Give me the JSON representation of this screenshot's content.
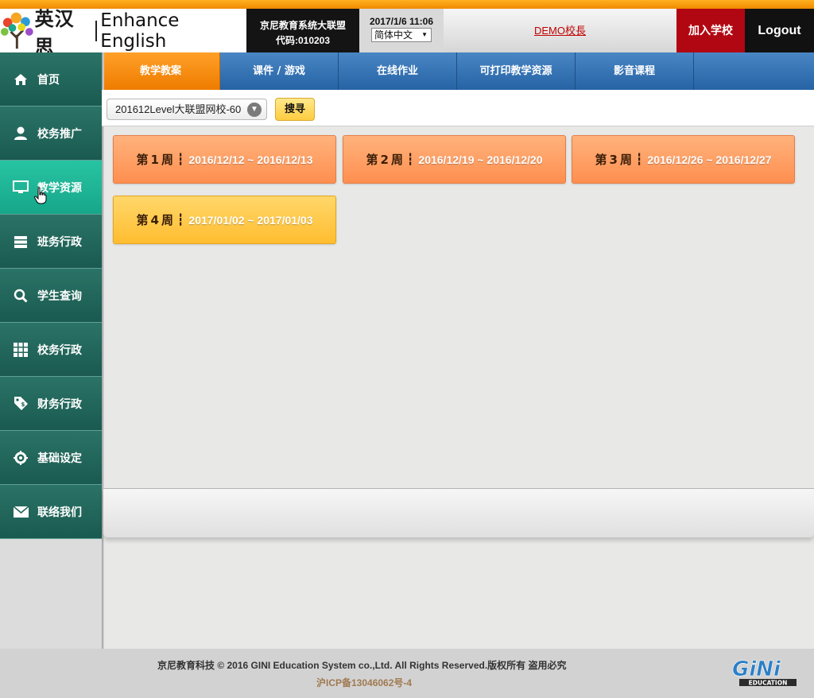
{
  "header": {
    "logo_cn": "英汉思",
    "logo_en": "Enhance English",
    "school_name": "京尼教育系统大联盟",
    "school_code": "代码:010203",
    "datetime": "2017/1/6 11:06",
    "language": "简体中文",
    "user_link": "DEMO校長",
    "join_label": "加入学校",
    "logout_label": "Logout"
  },
  "sidebar": {
    "items": [
      {
        "label": "首页",
        "icon": "home-icon"
      },
      {
        "label": "校务推广",
        "icon": "user-icon"
      },
      {
        "label": "教学资源",
        "icon": "monitor-icon"
      },
      {
        "label": "班务行政",
        "icon": "list-icon"
      },
      {
        "label": "学生查询",
        "icon": "search-icon"
      },
      {
        "label": "校务行政",
        "icon": "grid-icon"
      },
      {
        "label": "财务行政",
        "icon": "price-tag-icon"
      },
      {
        "label": "基础设定",
        "icon": "gear-icon"
      },
      {
        "label": "联络我们",
        "icon": "envelope-icon"
      }
    ],
    "active_index": 2
  },
  "tabs": [
    {
      "label": "教学教案"
    },
    {
      "label": "课件 / 游戏"
    },
    {
      "label": "在线作业"
    },
    {
      "label": "可打印教学资源"
    },
    {
      "label": "影音课程"
    }
  ],
  "filter": {
    "class_value": "201612Level大联盟网校-60",
    "search_label": "搜寻"
  },
  "weeks": [
    {
      "prefix": "第",
      "num": "1",
      "suffix": "周",
      "range": "2016/12/12 ~ 2016/12/13"
    },
    {
      "prefix": "第",
      "num": "2",
      "suffix": "周",
      "range": "2016/12/19 ~ 2016/12/20"
    },
    {
      "prefix": "第",
      "num": "3",
      "suffix": "周",
      "range": "2016/12/26 ~ 2016/12/27"
    },
    {
      "prefix": "第",
      "num": "4",
      "suffix": "周",
      "range": "2017/01/02 ~ 2017/01/03"
    }
  ],
  "footer": {
    "copyright": "京尼教育科技 © 2016 GINI Education System co.,Ltd. All Rights Reserved.版权所有 盗用必究",
    "icp": "沪ICP备13046062号-4",
    "brand": "GiNi",
    "brand_sub": "EDUCATION"
  },
  "colors": {
    "accent_orange": "#ff8f50",
    "tab_blue": "#2563a5",
    "sidebar_teal": "#1a5a50",
    "active_teal": "#17a68a",
    "join_red": "#b10712"
  }
}
